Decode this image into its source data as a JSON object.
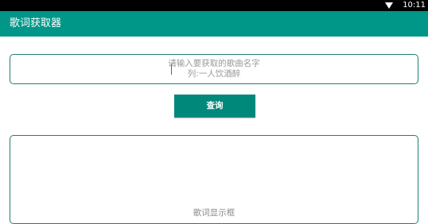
{
  "status_bar": {
    "time": "10:11",
    "wifi_icon": "wifi-icon"
  },
  "app_bar": {
    "title": "歌词获取器",
    "background": "#009688"
  },
  "search": {
    "placeholder": "请输入要获取的歌曲名字\n列:一人饮酒醉",
    "value": ""
  },
  "query_button": {
    "label": "查询",
    "color": "#00897b"
  },
  "lyrics_display": {
    "text": "歌词显示框"
  }
}
